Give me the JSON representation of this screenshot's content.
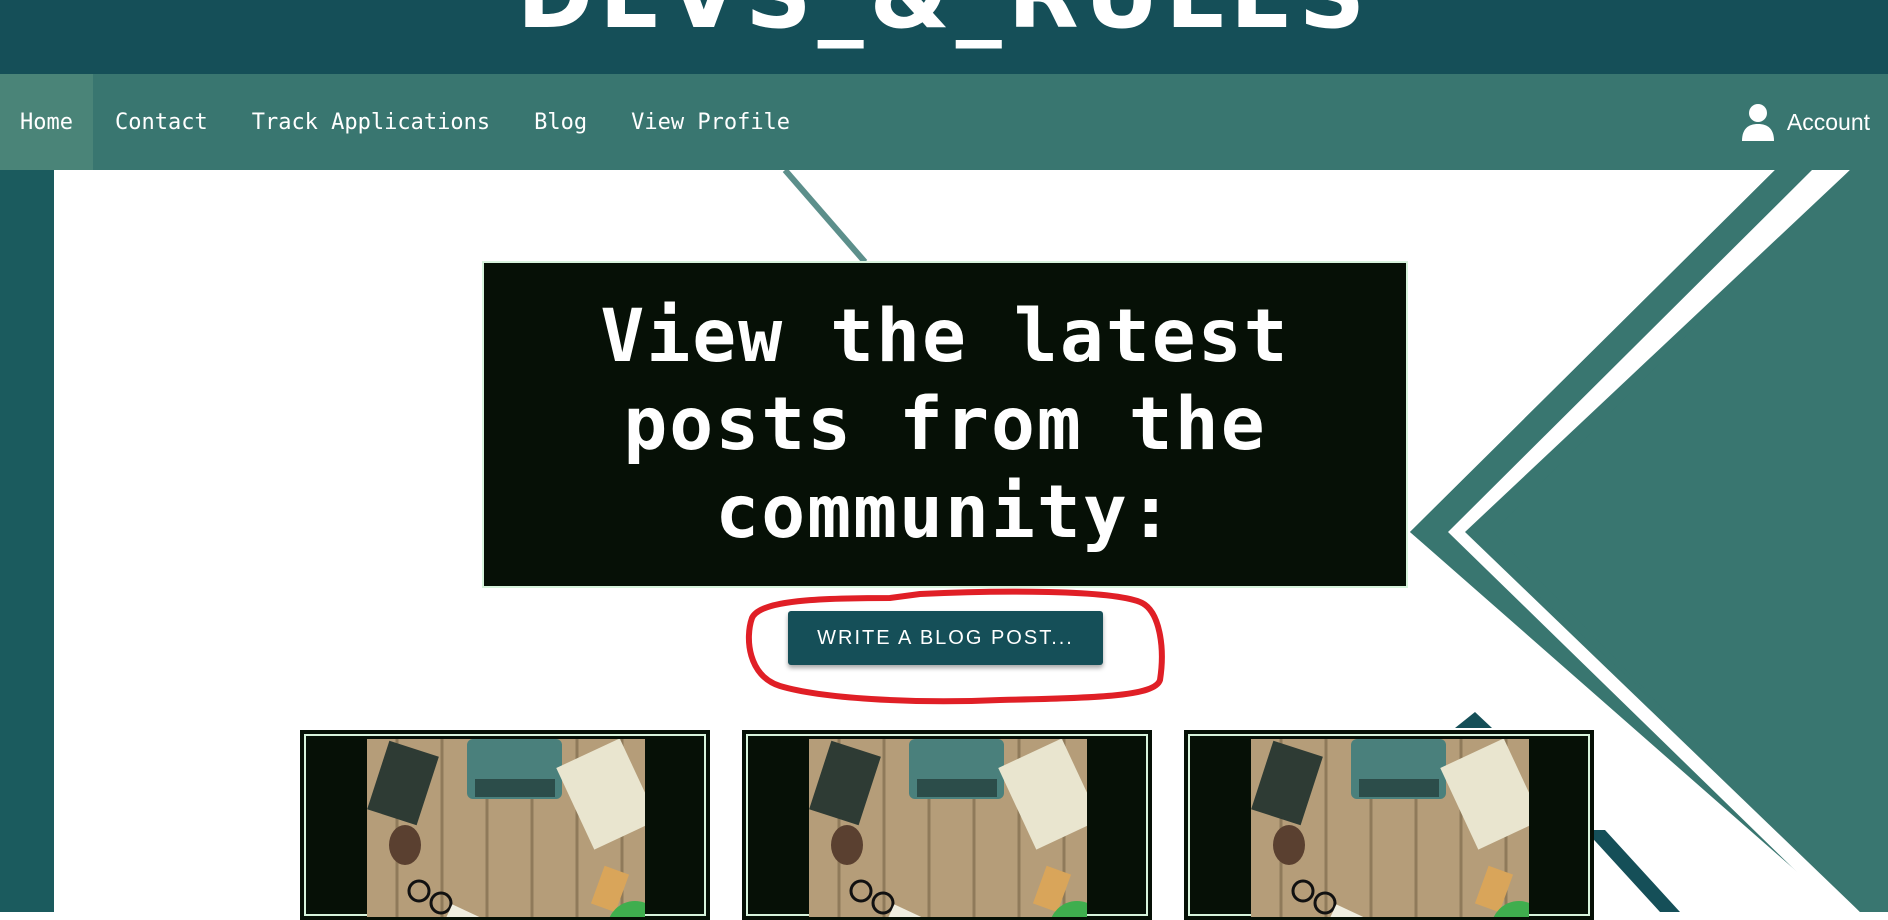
{
  "header": {
    "site_title": "DEVS_&_RULES"
  },
  "nav": {
    "items": [
      {
        "label": "Home",
        "active": true
      },
      {
        "label": "Contact"
      },
      {
        "label": "Track Applications"
      },
      {
        "label": "Blog"
      },
      {
        "label": "View Profile"
      }
    ],
    "account_label": "Account",
    "account_icon": "user-icon"
  },
  "hero": {
    "text": "View the latest posts from the community:"
  },
  "cta": {
    "label": "WRITE A BLOG POST..."
  },
  "cards": [
    {
      "image": "typewriter-desk-photo"
    },
    {
      "image": "typewriter-desk-photo"
    },
    {
      "image": "typewriter-desk-photo"
    }
  ],
  "colors": {
    "header_bg": "#154f58",
    "nav_bg": "#397670",
    "hero_bg": "#061006",
    "accent_green": "#3fae4e",
    "annotation_red": "#e01f26"
  }
}
